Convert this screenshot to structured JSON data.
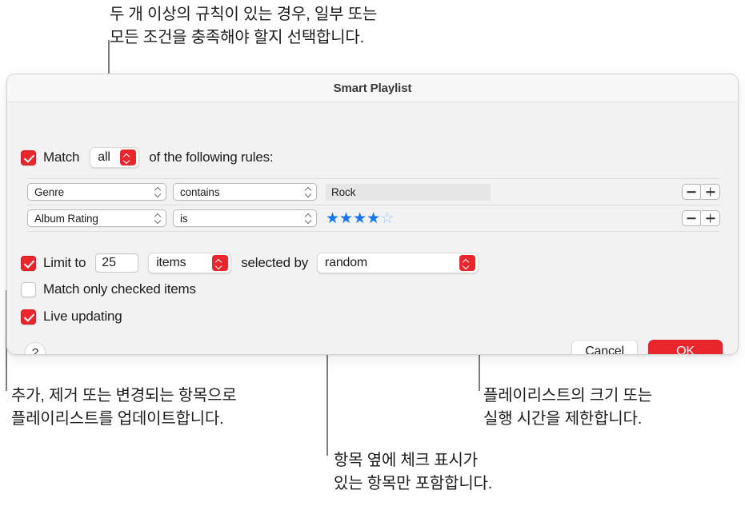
{
  "callouts": {
    "top": "두 개 이상의 규칙이 있는 경우, 일부 또는\n모든 조건을 충족해야 할지 선택합니다.",
    "left": "추가, 제거 또는 변경되는 항목으로\n플레이리스트를 업데이트합니다.",
    "middle": "항목 옆에 체크 표시가\n있는 항목만 포함합니다.",
    "right": "플레이리스트의 크기 또는\n실행 시간을 제한합니다."
  },
  "dialog": {
    "title": "Smart Playlist",
    "match": {
      "checked": true,
      "label": "Match",
      "selected": "all",
      "suffix": "of the following rules:"
    },
    "rules_columns": [
      "field",
      "operator",
      "value"
    ],
    "rules": [
      {
        "field": "Genre",
        "operator": "contains",
        "value": "Rock",
        "value_type": "text",
        "remove_label": "−",
        "add_label": "+"
      },
      {
        "field": "Album Rating",
        "operator": "is",
        "value": "★★★★☆",
        "value_type": "stars",
        "stars_filled": 4,
        "stars_total": 5,
        "remove_label": "−",
        "add_label": "+"
      }
    ],
    "limit": {
      "checked": true,
      "label": "Limit to",
      "amount": "25",
      "unit": "items",
      "selected_by_label": "selected by",
      "selection_method": "random"
    },
    "match_only_checked": {
      "checked": false,
      "label": "Match only checked items"
    },
    "live_updating": {
      "checked": true,
      "label": "Live updating"
    },
    "help_label": "?",
    "cancel_label": "Cancel",
    "ok_label": "OK"
  },
  "colors": {
    "accent_red": "#e8262c",
    "star_blue": "#1476f0",
    "leader_gray": "#7d7d7d",
    "dialog_bg": "#f2f2f2"
  }
}
